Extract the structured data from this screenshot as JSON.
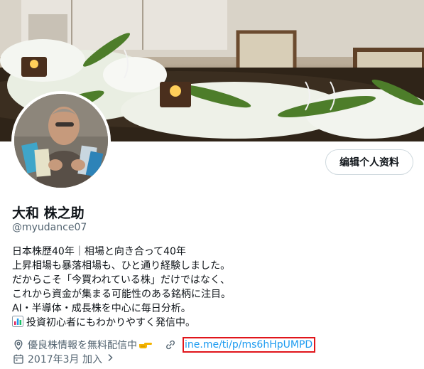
{
  "profile": {
    "display_name": "大和 株之助",
    "handle": "@myudance07",
    "edit_button_label": "编辑个人资料",
    "bio_lines": [
      "日本株歴40年｜相場と向き合って40年",
      "上昇相場も暴落相場も、ひと通り経験しました。",
      "だからこそ「今買われている株」だけではなく、",
      "これから資金が集まる可能性のある銘柄に注目。",
      "AI・半導体・成長株を中心に毎日分析。",
      "投資初心者にもわかりやすく発信中。"
    ],
    "location": "優良株情報を無料配信中",
    "website": "ine.me/ti/p/ms6hHpUMPD",
    "joined": "2017年3月 加入"
  },
  "icons": {
    "location": "location-pin-icon",
    "link": "link-icon",
    "calendar": "calendar-icon",
    "chart_emoji": "bar-chart-emoji",
    "pointing_emoji": "pointing-hand-emoji"
  },
  "colors": {
    "link": "#1d9bf0",
    "secondary_text": "#536471",
    "highlight_box": "#e0151b"
  }
}
